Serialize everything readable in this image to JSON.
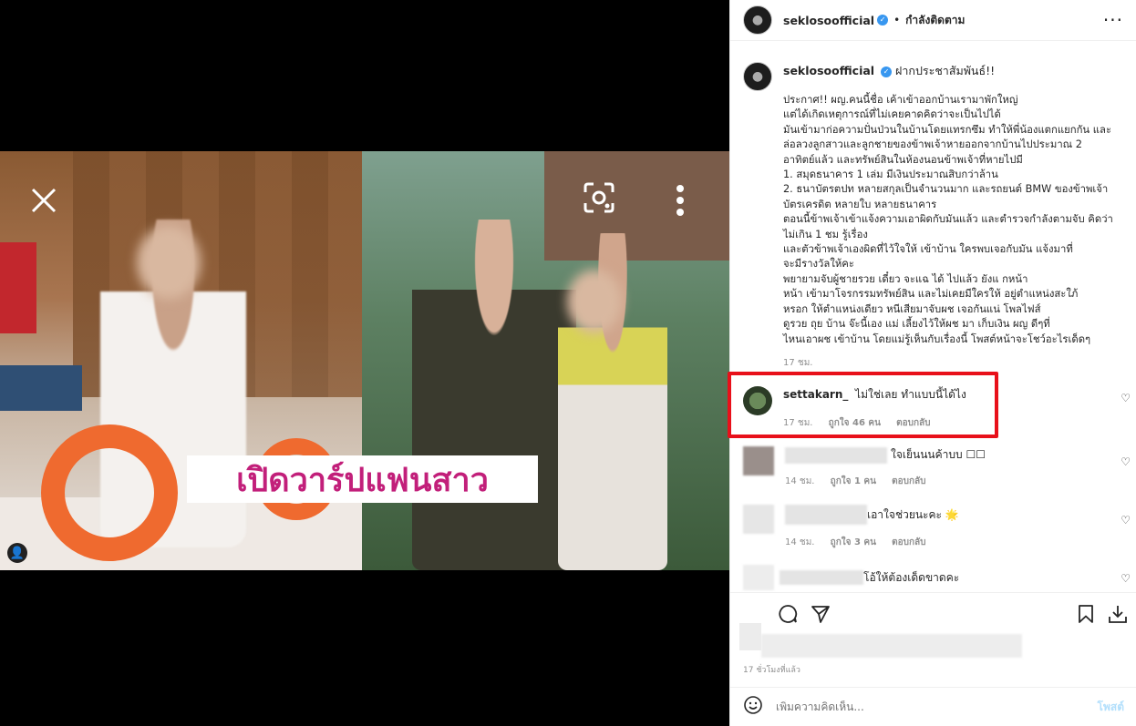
{
  "media": {
    "banner_text": "เปิดวาร์ปแฟนสาว",
    "close_icon": "close-icon",
    "lens_icon": "lens-icon",
    "more_icon": "more-vertical-icon"
  },
  "header": {
    "username": "seklosoofficial",
    "separator": "•",
    "follow_status": "กำลังติดตาม",
    "more": "···"
  },
  "caption": {
    "username": "seklosoofficial",
    "title_suffix": "ฝากประชาสัมพันธ์!!",
    "body": "ประกาศ!! ผญ.คนนี้ชื่อ                      เค้าเข้าออกบ้านเรามาพักใหญ่\nแต่ได้เกิดเหตุการณ์ที่ไม่เคยคาดคิดว่าจะเป็นไปได้\nมันเข้ามาก่อความปั่นป่วนในบ้านโดยแทรกซึม ทำให้พี่น้องแตกแยกกัน และ\nล่อลวงลูกสาวและลูกชายของข้าพเจ้าหายออกจากบ้านไปประมาณ 2\nอาทิตย์แล้ว และทรัพย์สินในห้องนอนข้าพเจ้าที่หายไปมี\n1. สมุดธนาคาร 1 เล่ม มีเงินประมาณสิบกว่าล้าน\n2. ธนาบัตรตปท หลายสกุลเป็นจำนวนมาก และรถยนต์ BMW ของข้าพเจ้า\nบัตรเครดิต หลายใบ หลายธนาคาร\nตอนนี้ข้าพเจ้าเข้าแจ้งความเอาผิดกับมันแล้ว และตำรวจกำลังตามจับ คิดว่า\nไม่เกิน 1 ชม รู้เรื่อง\nและตัวข้าพเจ้าเองผิดที่ไว้ใจให้    เข้าบ้าน ใครพบเจอกับมัน แจ้งมาที่\n                       จะมีรางวัลให้คะ\nพยายามจับผู้ชายรวย          เดี๋ยว   จะแฉ     ได้   ไปแล้ว ยังแ     กหน้า\nหน้า     เข้ามาโจรกรรมทรัพย์สิน   และไม่เคยมีใครให้   อยู่ตำแหน่งสะใภ้\nหรอก ให้ตำแหน่งเดียว                  หนีเสียมาจับผช เจอกันแน่ โพลไฟส์\nดูรวย ถุย บ้าน          จ๊ะนี้เอง แม่    เลี้ยงไว้ให้ผช มา     เก็บเงิน ผญ ดีๆที่\nไหนเอาผช เข้าบ้าน โดยแม่รู้เห็นกับเรื่องนี้ โพสต์หน้าจะโชว์อะไรเด็ดๆ",
    "time": "17 ชม."
  },
  "comments": [
    {
      "username": "settakarn_",
      "text": "ไม่ใช่เลย ทำแบบนี้ได้ไง",
      "time": "17 ชม.",
      "likes": "ถูกใจ 46 คน",
      "reply": "ตอบกลับ"
    },
    {
      "username": "",
      "text": "ใจเย็นนนค้าบบ ☐☐",
      "time": "14 ชม.",
      "likes": "ถูกใจ 1 คน",
      "reply": "ตอบกลับ"
    },
    {
      "username": "",
      "text": "เอาใจช่วยนะคะ 🌟",
      "time": "14 ชม.",
      "likes": "ถูกใจ 3 คน",
      "reply": "ตอบกลับ"
    },
    {
      "username": "",
      "text": "โอ้ให้ต้องเด็ดขาดคะ",
      "time": "",
      "likes": "",
      "reply": ""
    }
  ],
  "footer": {
    "time_ago": "17 ชั่วโมงที่แล้ว",
    "comment_placeholder": "เพิ่มความคิดเห็น...",
    "post_label": "โพสต์"
  },
  "colors": {
    "verified": "#3897f0",
    "highlight_box": "#e8101a",
    "post_button": "#b2dffc"
  }
}
